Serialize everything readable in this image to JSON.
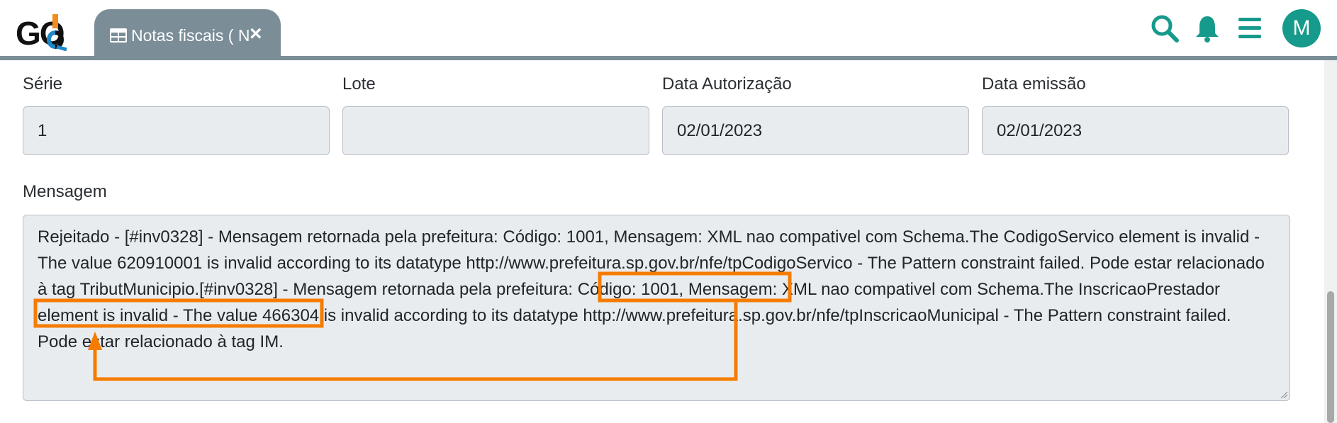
{
  "app": {
    "logo_text": "GO",
    "tab_label": "Notas fiscais ( NFS-e )",
    "tab_close": "×",
    "avatar_initial": "M"
  },
  "icons": {
    "logo": "go-logo-icon",
    "tab": "table-icon",
    "search": "search-icon",
    "notifications": "bell-icon",
    "menu": "hamburger-menu-icon"
  },
  "colors": {
    "accent": "#159a8b",
    "tab_bg": "#7b8d97",
    "annotation": "#f57c00",
    "field_bg": "#e9ecef"
  },
  "form": {
    "serie": {
      "label": "Série",
      "value": "1"
    },
    "lote": {
      "label": "Lote",
      "value": ""
    },
    "data_autorizacao": {
      "label": "Data Autorização",
      "value": "02/01/2023"
    },
    "data_emissao": {
      "label": "Data emissão",
      "value": "02/01/2023"
    },
    "mensagem": {
      "label": "Mensagem",
      "value": "Rejeitado - [#inv0328] - Mensagem retornada pela prefeitura: Código: 1001, Mensagem: XML nao compativel com Schema.The CodigoServico element is invalid - The value 620910001 is invalid according to its datatype http://www.prefeitura.sp.gov.br/nfe/tpCodigoServico - The Pattern constraint failed. Pode estar relacionado à tag TributMunicipio.[#inv0328] - Mensagem retornada pela prefeitura: Código: 1001, Mensagem: XML nao compativel com Schema.The InscricaoPrestador element is invalid - The value 466304 is invalid according to its datatype http://www.prefeitura.sp.gov.br/nfe/tpInscricaoMunicipal - The Pattern constraint failed. Pode estar relacionado à tag IM."
    }
  }
}
